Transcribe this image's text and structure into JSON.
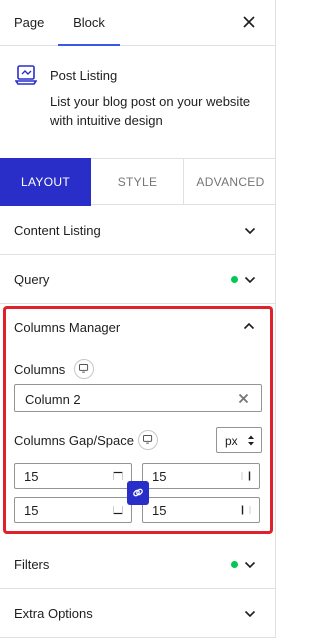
{
  "top_tabs": {
    "page": "Page",
    "block": "Block"
  },
  "block_card": {
    "title": "Post Listing",
    "description": "List your blog post on your website with intuitive design"
  },
  "sub_tabs": {
    "layout": "LAYOUT",
    "style": "STYLE",
    "advanced": "ADVANCED"
  },
  "panels": {
    "content_listing": "Content Listing",
    "query": "Query",
    "columns_manager": "Columns Manager",
    "filters": "Filters",
    "extra_options": "Extra Options"
  },
  "columns": {
    "label": "Columns",
    "selected": "Column 2"
  },
  "gap": {
    "label": "Columns Gap/Space",
    "unit": "px",
    "top": "15",
    "right": "15",
    "bottom": "15",
    "left": "15"
  },
  "colors": {
    "accent": "#2a2ec9",
    "status_dot": "#00c853",
    "highlight": "#e0202a"
  }
}
